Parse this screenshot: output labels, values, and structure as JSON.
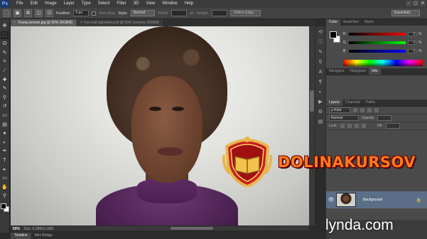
{
  "app": {
    "logo": "Ps"
  },
  "menu": [
    "File",
    "Edit",
    "Image",
    "Layer",
    "Type",
    "Select",
    "Filter",
    "3D",
    "View",
    "Window",
    "Help"
  ],
  "window_controls": [
    "–",
    "▢",
    "✕"
  ],
  "options_bar": {
    "feather_label": "Feather:",
    "feather_value": "0 px",
    "anti_alias_label": "Anti-alias",
    "style_label": "Style:",
    "style_value": "Normal",
    "width_label": "Width:",
    "height_label": "Height:",
    "refine_edge": "Refine Edge...",
    "workspace": "Essentials"
  },
  "tools": [
    "move-icon",
    "marquee-icon",
    "lasso-icon",
    "quick-select-icon",
    "crop-icon",
    "eyedropper-icon",
    "healing-icon",
    "brush-icon",
    "stamp-icon",
    "history-brush-icon",
    "eraser-icon",
    "gradient-icon",
    "blur-icon",
    "dodge-icon",
    "pen-icon",
    "type-icon",
    "path-select-icon",
    "shape-icon",
    "hand-icon",
    "zoom-icon"
  ],
  "tool_glyphs": [
    "✥",
    "⬚",
    "ʘ",
    "✎",
    "⌗",
    "⁄",
    "✚",
    "✎",
    "⚲",
    "↺",
    "▭",
    "▤",
    "●",
    "◐",
    "✒",
    "T",
    "▸",
    "▭",
    "✋",
    "⚲"
  ],
  "doc_tabs": [
    {
      "label": "Young woman.jpg @ 50% (RGB/8)",
      "active": true
    },
    {
      "label": "Ice-cold vignettes.psd @ 50% (woman, RGB/8)",
      "active": false
    }
  ],
  "status": {
    "zoom": "50%",
    "doc": "Doc: 6.38M/3.18M"
  },
  "bottom_tabs": [
    {
      "label": "Timeline",
      "active": true
    },
    {
      "label": "Mini Bridge",
      "active": false
    }
  ],
  "color_panel": {
    "tabs": [
      {
        "label": "Color",
        "active": true
      },
      {
        "label": "Swatches",
        "active": false
      },
      {
        "label": "Styles",
        "active": false
      }
    ],
    "rows": [
      {
        "channel": "R",
        "value": "0",
        "pct": "%",
        "gradient": "#000000,#ff0000"
      },
      {
        "channel": "G",
        "value": "0",
        "pct": "%",
        "gradient": "#000000,#00ff00"
      },
      {
        "channel": "B",
        "value": "0",
        "pct": "%",
        "gradient": "#000000,#0000ff"
      }
    ]
  },
  "mid_tabs": [
    {
      "label": "Navigator",
      "active": false
    },
    {
      "label": "Histogram",
      "active": false
    },
    {
      "label": "Info",
      "active": true
    }
  ],
  "layers_panel": {
    "tabs": [
      {
        "label": "Layers",
        "active": true
      },
      {
        "label": "Channels",
        "active": false
      },
      {
        "label": "Paths",
        "active": false
      }
    ],
    "kind": "ρ Kind",
    "blend_mode": "Normal",
    "opacity_label": "Opacity:",
    "lock_label": "Lock:",
    "fill_label": "Fill:",
    "layer_name": "Background"
  },
  "overlay": {
    "brand": "DOLINAKURSOV",
    "watermark": "lynda.com"
  },
  "colors": {
    "accent": "#5a6f87",
    "brand_orange": "#ff7a1a"
  }
}
